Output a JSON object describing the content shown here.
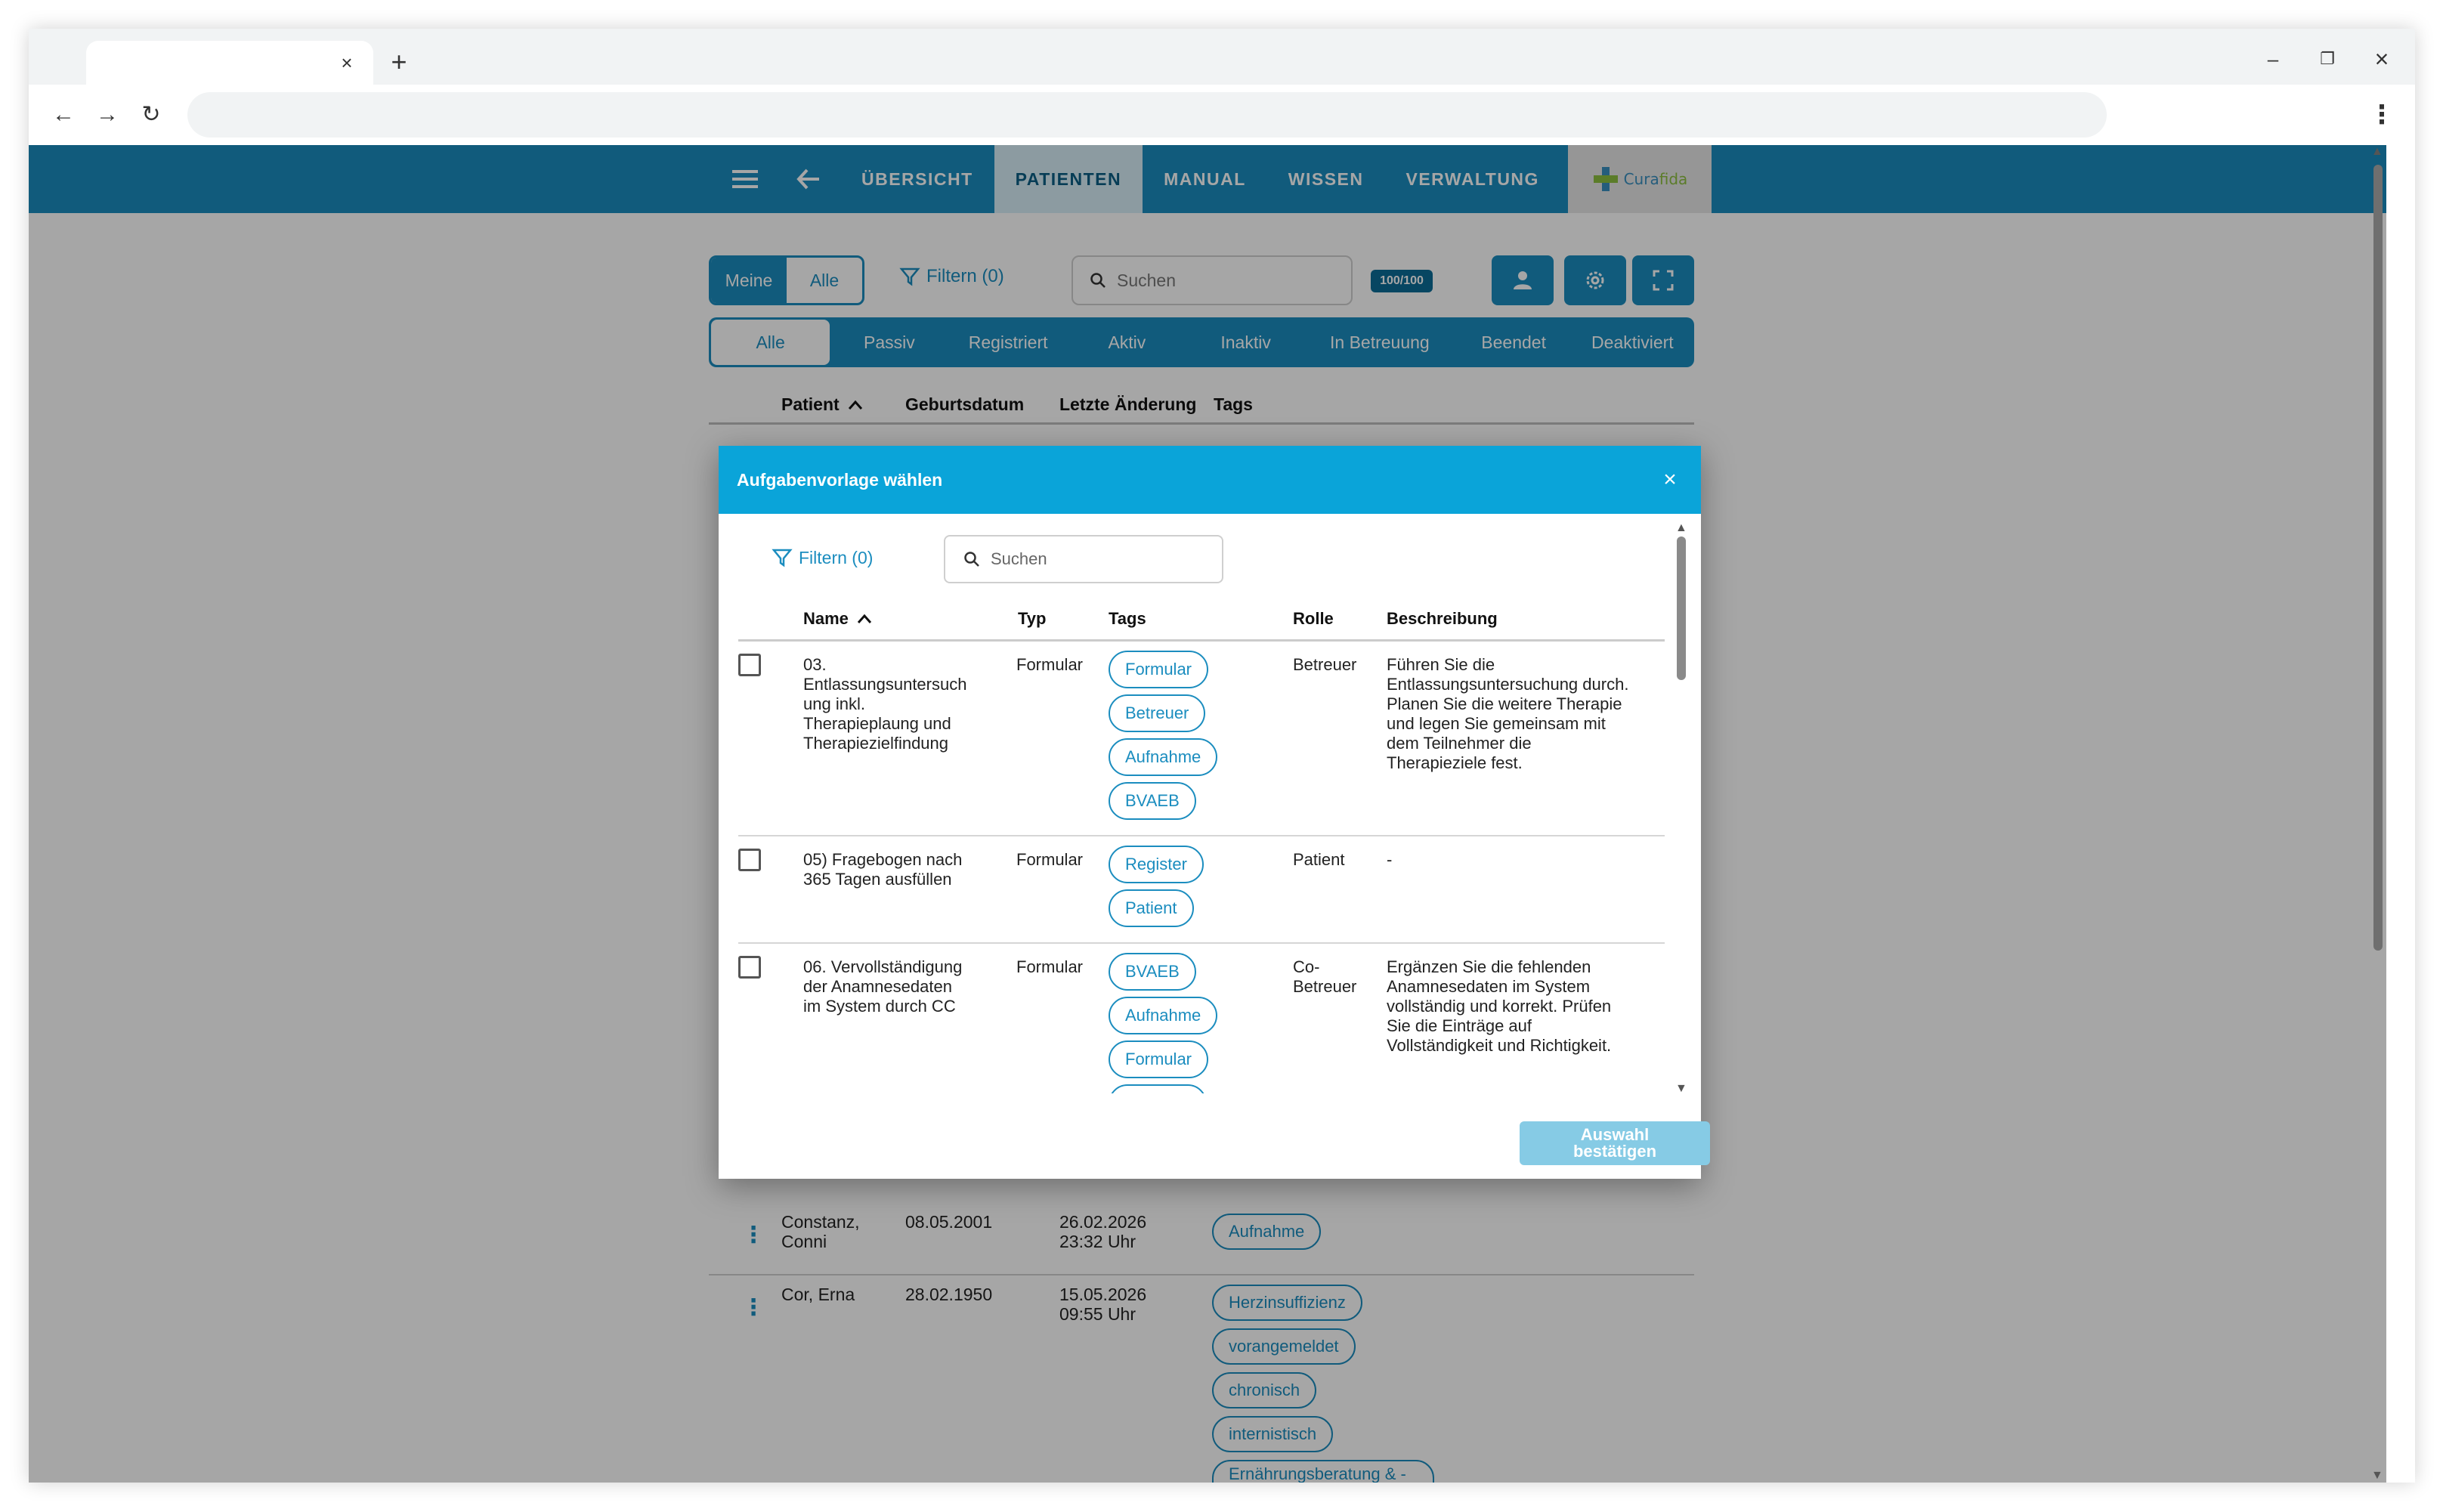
{
  "browser": {
    "tab_close": "×",
    "new_tab": "+",
    "minimize": "–",
    "restore": "❐",
    "close": "×",
    "back": "←",
    "forward": "→",
    "reload": "↻",
    "menu": "⋮"
  },
  "nav": {
    "items": [
      "Übersicht",
      "Patienten",
      "Manual",
      "Wissen",
      "Verwaltung"
    ],
    "active": "Patienten",
    "logo_text_a": "Cura",
    "logo_text_b": "fida"
  },
  "toolbar": {
    "scope_mine": "Meine",
    "scope_all": "Alle",
    "filter_label": "Filtern (0)",
    "search_placeholder": "Suchen",
    "count_badge": "100/100"
  },
  "status_tabs": [
    "Alle",
    "Passiv",
    "Registriert",
    "Aktiv",
    "Inaktiv",
    "In Betreuung",
    "Beendet",
    "Deaktiviert"
  ],
  "table": {
    "headers": [
      "Patient",
      "Geburtsdatum",
      "Letzte Änderung",
      "Tags"
    ],
    "rows": [
      {
        "name_line1": "Constanz,",
        "name_line2": "Conni",
        "birth": "08.05.2001",
        "changed_line1": "26.02.2026",
        "changed_line2": "23:32 Uhr",
        "tags": [
          "Aufnahme"
        ]
      },
      {
        "name_line1": "Cor, Erna",
        "name_line2": "",
        "birth": "28.02.1950",
        "changed_line1": "15.05.2026",
        "changed_line2": "09:55 Uhr",
        "tags": [
          "Herzinsuffizienz",
          "vorangemeldet",
          "chronisch",
          "internistisch",
          "Ernährungsberatung & -therapie"
        ]
      }
    ]
  },
  "dialog": {
    "title": "Aufgabenvorlage wählen",
    "close": "×",
    "filter_label": "Filtern (0)",
    "search_placeholder": "Suchen",
    "headers": [
      "Name",
      "Typ",
      "Tags",
      "Rolle",
      "Beschreibung"
    ],
    "rows": [
      {
        "name": [
          "03.",
          "Entlassungsuntersuch",
          "ung inkl.",
          "Therapieplaung und",
          "Therapiezielfindung"
        ],
        "type": "Formular",
        "tags": [
          "Formular",
          "Betreuer",
          "Aufnahme",
          "BVAEB"
        ],
        "role": [
          "Betreuer"
        ],
        "desc": [
          "Führen Sie die",
          "Entlassungsuntersuchung durch.",
          "Planen Sie die weitere Therapie",
          "und legen Sie gemeinsam mit",
          "dem Teilnehmer die",
          "Therapieziele fest."
        ]
      },
      {
        "name": [
          "05) Fragebogen nach",
          "365 Tagen ausfüllen"
        ],
        "type": "Formular",
        "tags": [
          "Register",
          "Patient"
        ],
        "role": [
          "Patient"
        ],
        "desc": [
          "-"
        ]
      },
      {
        "name": [
          "06. Vervollständigung",
          "der Anamnesedaten",
          "im System durch CC"
        ],
        "type": "Formular",
        "tags": [
          "BVAEB",
          "Aufnahme",
          "Formular"
        ],
        "role": [
          "Co-",
          "Betreuer"
        ],
        "desc": [
          "Ergänzen Sie die fehlenden",
          "Anamnesedaten im System",
          "vollständig und korrekt. Prüfen",
          "Sie die Einträge auf",
          "Vollständigkeit und Richtigkeit."
        ]
      }
    ],
    "confirm_line1": "Auswahl",
    "confirm_line2": "bestätigen"
  },
  "colors": {
    "primary": "#1b8dbf",
    "dialog_header": "#0aa4d9",
    "confirm_disabled": "#86cbe5",
    "logo_blue": "#3a8fbf",
    "logo_green": "#8cbf3f"
  },
  "icons": [
    "hamburger-menu-icon",
    "back-arrow-icon",
    "filter-icon",
    "search-icon",
    "add-person-icon",
    "gear-icon",
    "fullscreen-icon",
    "sort-asc-icon",
    "kebab-icon",
    "close-icon"
  ]
}
